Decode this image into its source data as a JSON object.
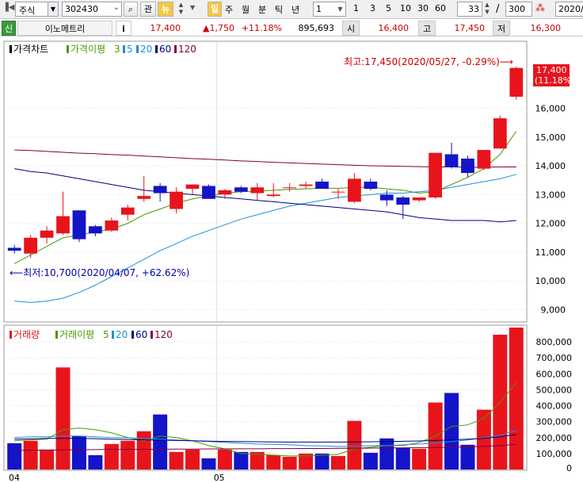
{
  "toolbar": {
    "market_select": "주식",
    "code_input": "302430",
    "search_btn": "⌕",
    "btn_gwan": "관",
    "btn_new": "뉴",
    "period_buttons": [
      "일",
      "주",
      "월",
      "분",
      "틱",
      "년"
    ],
    "interval_select": "1",
    "interval_buttons": [
      "1",
      "3",
      "5",
      "10",
      "30",
      "60"
    ],
    "count_input": "33",
    "count_sep": "/",
    "count_total": "300",
    "date_input": "2020/"
  },
  "info": {
    "prefix": "신",
    "name": "이노메트리",
    "info_btn": "i",
    "price": "17,400",
    "change": "▲1,750",
    "change_pct": "+11.18%",
    "volume": "895,693",
    "open_label": "시",
    "open": "16,400",
    "high_label": "고",
    "high": "17,450",
    "low_label": "저",
    "low": "16,300"
  },
  "colors": {
    "up": "#e8141c",
    "down": "#1414c8",
    "ma5": "#4a9a00",
    "ma20": "#1e90d8",
    "ma60": "#000080",
    "ma120": "#800040",
    "text_red": "#cc0000",
    "text_blue": "#0000cc"
  },
  "chart_data": [
    {
      "type": "candlestick",
      "legend": {
        "title": "가격차트",
        "ma_label": "가격이평",
        "ma_items": [
          "3",
          "5",
          "20",
          "60",
          "120"
        ]
      },
      "y_ticks": [
        9000,
        10000,
        11000,
        12000,
        13000,
        14000,
        15000,
        16000
      ],
      "y_tick_labels": [
        "9,000",
        "10,000",
        "11,000",
        "12,000",
        "13,000",
        "14,000",
        "15,000",
        "16,000"
      ],
      "ylim": [
        8600,
        18300
      ],
      "ohlc": [
        [
          11150,
          11250,
          10950,
          11050
        ],
        [
          10950,
          11600,
          10800,
          11500
        ],
        [
          11500,
          11900,
          11300,
          11750
        ],
        [
          11650,
          13100,
          11600,
          12250
        ],
        [
          12450,
          12450,
          11350,
          11450
        ],
        [
          11900,
          11950,
          11550,
          11650
        ],
        [
          11750,
          12200,
          11700,
          12100
        ],
        [
          12300,
          12650,
          12100,
          12550
        ],
        [
          12850,
          13650,
          12750,
          12950
        ],
        [
          13300,
          13400,
          12750,
          13050
        ],
        [
          12500,
          13250,
          12350,
          13100
        ],
        [
          13200,
          13350,
          13000,
          13350
        ],
        [
          13300,
          13350,
          12900,
          12850
        ],
        [
          13000,
          13200,
          12850,
          13150
        ],
        [
          13250,
          13300,
          13050,
          13100
        ],
        [
          13050,
          13400,
          12800,
          13250
        ],
        [
          12950,
          13400,
          12900,
          13000
        ],
        [
          13250,
          13400,
          13100,
          13250
        ],
        [
          13300,
          13450,
          13200,
          13350
        ],
        [
          13450,
          13550,
          13200,
          13200
        ],
        [
          13100,
          13200,
          12850,
          13100
        ],
        [
          12750,
          13750,
          12700,
          13550
        ],
        [
          13450,
          13550,
          13150,
          13200
        ],
        [
          13000,
          13150,
          12600,
          12800
        ],
        [
          12900,
          12950,
          12150,
          12650
        ],
        [
          12800,
          12900,
          12750,
          12900
        ],
        [
          12900,
          14450,
          12850,
          14450
        ],
        [
          14400,
          14800,
          13900,
          13950
        ],
        [
          14250,
          14350,
          13600,
          13750
        ],
        [
          13900,
          14550,
          13850,
          14550
        ],
        [
          14600,
          15750,
          14600,
          15650
        ],
        [
          16400,
          17450,
          16300,
          17400
        ]
      ],
      "ma": {
        "ma5": [
          10600,
          10900,
          11200,
          11500,
          11600,
          11700,
          11800,
          12000,
          12300,
          12500,
          12700,
          12850,
          12950,
          13050,
          13100,
          13120,
          13150,
          13180,
          13200,
          13220,
          13220,
          13250,
          13260,
          13200,
          13150,
          13050,
          13100,
          13350,
          13600,
          13900,
          14400,
          15200
        ],
        "ma20": [
          9300,
          9250,
          9300,
          9400,
          9600,
          9850,
          10150,
          10450,
          10750,
          11050,
          11300,
          11550,
          11750,
          11950,
          12150,
          12300,
          12450,
          12600,
          12700,
          12800,
          12900,
          12950,
          13000,
          13050,
          13050,
          13100,
          13150,
          13250,
          13350,
          13450,
          13550,
          13700
        ],
        "ma60": [
          13900,
          13800,
          13750,
          13650,
          13550,
          13450,
          13350,
          13250,
          13150,
          13100,
          13050,
          13000,
          12950,
          12900,
          12850,
          12800,
          12750,
          12700,
          12650,
          12600,
          12550,
          12500,
          12450,
          12400,
          12300,
          12200,
          12150,
          12100,
          12100,
          12100,
          12050,
          12100
        ],
        "ma120": [
          14550,
          14530,
          14500,
          14470,
          14440,
          14420,
          14390,
          14370,
          14340,
          14310,
          14280,
          14250,
          14230,
          14200,
          14170,
          14150,
          14120,
          14100,
          14080,
          14060,
          14040,
          14020,
          14000,
          13990,
          13980,
          13970,
          13960,
          13960,
          13950,
          13950,
          13960,
          13960
        ]
      },
      "annotations": {
        "high": "최고:17,450(2020/05/27, -0.29%)⟶",
        "low": "⟵최저:10,700(2020/04/07, +62.62%)"
      },
      "last_price_tag": [
        "17,400",
        "(11.18%)"
      ]
    },
    {
      "type": "bar",
      "legend": {
        "title": "거래량",
        "ma_label": "거래이평",
        "ma_items": [
          "5",
          "20",
          "60",
          "120"
        ]
      },
      "y_ticks": [
        100000,
        200000,
        300000,
        400000,
        500000,
        600000,
        700000,
        800000
      ],
      "y_tick_labels": [
        "100,000",
        "200,000",
        "300,000",
        "400,000",
        "500,000",
        "600,000",
        "700,000",
        "800,000"
      ],
      "zero_label": "0",
      "ylim": [
        0,
        900000
      ],
      "volume": [
        165000,
        180000,
        125000,
        640000,
        210000,
        90000,
        160000,
        180000,
        240000,
        345000,
        110000,
        125000,
        70000,
        125000,
        110000,
        110000,
        90000,
        80000,
        100000,
        100000,
        85000,
        305000,
        105000,
        195000,
        135000,
        130000,
        420000,
        480000,
        155000,
        375000,
        845000,
        890000
      ],
      "ma": {
        "ma5": [
          180000,
          185000,
          190000,
          250000,
          260000,
          250000,
          230000,
          200000,
          180000,
          210000,
          200000,
          180000,
          150000,
          130000,
          100000,
          95000,
          90000,
          85000,
          85000,
          90000,
          95000,
          130000,
          140000,
          150000,
          150000,
          170000,
          210000,
          270000,
          280000,
          320000,
          420000,
          545000
        ],
        "ma20": [
          200000,
          205000,
          205000,
          210000,
          210000,
          205000,
          200000,
          198000,
          195000,
          190000,
          185000,
          180000,
          175000,
          170000,
          165000,
          160000,
          158000,
          155000,
          150000,
          148000,
          145000,
          145000,
          150000,
          150000,
          155000,
          160000,
          165000,
          175000,
          185000,
          200000,
          215000,
          245000
        ],
        "ma60": [
          190000,
          192000,
          195000,
          195000,
          195000,
          193000,
          190000,
          188000,
          186000,
          184000,
          182000,
          180000,
          178000,
          176000,
          175000,
          174000,
          173000,
          172000,
          172000,
          172000,
          172000,
          173000,
          174000,
          175000,
          177000,
          179000,
          182000,
          186000,
          190000,
          195000,
          205000,
          220000
        ],
        "ma120": [
          120000,
          121000,
          122000,
          123000,
          124000,
          125000,
          126000,
          126000,
          127000,
          127000,
          128000,
          128000,
          129000,
          129000,
          130000,
          130000,
          131000,
          131000,
          132000,
          132000,
          133000,
          133000,
          134000,
          135000,
          136000,
          137000,
          138000,
          140000,
          142000,
          145000,
          150000,
          158000
        ]
      },
      "x_labels": [
        "04",
        "05"
      ]
    }
  ]
}
